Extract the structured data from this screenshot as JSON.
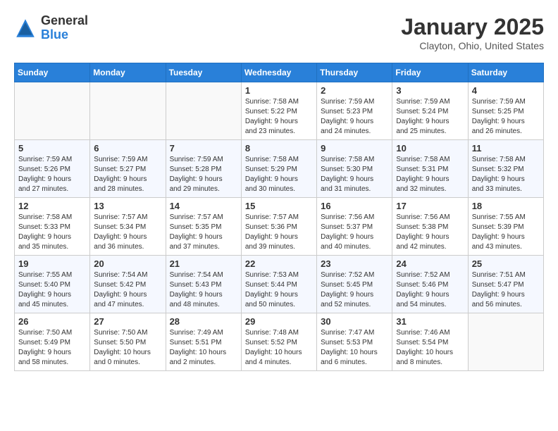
{
  "header": {
    "logo_general": "General",
    "logo_blue": "Blue",
    "month": "January 2025",
    "location": "Clayton, Ohio, United States"
  },
  "weekdays": [
    "Sunday",
    "Monday",
    "Tuesday",
    "Wednesday",
    "Thursday",
    "Friday",
    "Saturday"
  ],
  "weeks": [
    [
      {
        "day": "",
        "info": ""
      },
      {
        "day": "",
        "info": ""
      },
      {
        "day": "",
        "info": ""
      },
      {
        "day": "1",
        "info": "Sunrise: 7:58 AM\nSunset: 5:22 PM\nDaylight: 9 hours\nand 23 minutes."
      },
      {
        "day": "2",
        "info": "Sunrise: 7:59 AM\nSunset: 5:23 PM\nDaylight: 9 hours\nand 24 minutes."
      },
      {
        "day": "3",
        "info": "Sunrise: 7:59 AM\nSunset: 5:24 PM\nDaylight: 9 hours\nand 25 minutes."
      },
      {
        "day": "4",
        "info": "Sunrise: 7:59 AM\nSunset: 5:25 PM\nDaylight: 9 hours\nand 26 minutes."
      }
    ],
    [
      {
        "day": "5",
        "info": "Sunrise: 7:59 AM\nSunset: 5:26 PM\nDaylight: 9 hours\nand 27 minutes."
      },
      {
        "day": "6",
        "info": "Sunrise: 7:59 AM\nSunset: 5:27 PM\nDaylight: 9 hours\nand 28 minutes."
      },
      {
        "day": "7",
        "info": "Sunrise: 7:59 AM\nSunset: 5:28 PM\nDaylight: 9 hours\nand 29 minutes."
      },
      {
        "day": "8",
        "info": "Sunrise: 7:58 AM\nSunset: 5:29 PM\nDaylight: 9 hours\nand 30 minutes."
      },
      {
        "day": "9",
        "info": "Sunrise: 7:58 AM\nSunset: 5:30 PM\nDaylight: 9 hours\nand 31 minutes."
      },
      {
        "day": "10",
        "info": "Sunrise: 7:58 AM\nSunset: 5:31 PM\nDaylight: 9 hours\nand 32 minutes."
      },
      {
        "day": "11",
        "info": "Sunrise: 7:58 AM\nSunset: 5:32 PM\nDaylight: 9 hours\nand 33 minutes."
      }
    ],
    [
      {
        "day": "12",
        "info": "Sunrise: 7:58 AM\nSunset: 5:33 PM\nDaylight: 9 hours\nand 35 minutes."
      },
      {
        "day": "13",
        "info": "Sunrise: 7:57 AM\nSunset: 5:34 PM\nDaylight: 9 hours\nand 36 minutes."
      },
      {
        "day": "14",
        "info": "Sunrise: 7:57 AM\nSunset: 5:35 PM\nDaylight: 9 hours\nand 37 minutes."
      },
      {
        "day": "15",
        "info": "Sunrise: 7:57 AM\nSunset: 5:36 PM\nDaylight: 9 hours\nand 39 minutes."
      },
      {
        "day": "16",
        "info": "Sunrise: 7:56 AM\nSunset: 5:37 PM\nDaylight: 9 hours\nand 40 minutes."
      },
      {
        "day": "17",
        "info": "Sunrise: 7:56 AM\nSunset: 5:38 PM\nDaylight: 9 hours\nand 42 minutes."
      },
      {
        "day": "18",
        "info": "Sunrise: 7:55 AM\nSunset: 5:39 PM\nDaylight: 9 hours\nand 43 minutes."
      }
    ],
    [
      {
        "day": "19",
        "info": "Sunrise: 7:55 AM\nSunset: 5:40 PM\nDaylight: 9 hours\nand 45 minutes."
      },
      {
        "day": "20",
        "info": "Sunrise: 7:54 AM\nSunset: 5:42 PM\nDaylight: 9 hours\nand 47 minutes."
      },
      {
        "day": "21",
        "info": "Sunrise: 7:54 AM\nSunset: 5:43 PM\nDaylight: 9 hours\nand 48 minutes."
      },
      {
        "day": "22",
        "info": "Sunrise: 7:53 AM\nSunset: 5:44 PM\nDaylight: 9 hours\nand 50 minutes."
      },
      {
        "day": "23",
        "info": "Sunrise: 7:52 AM\nSunset: 5:45 PM\nDaylight: 9 hours\nand 52 minutes."
      },
      {
        "day": "24",
        "info": "Sunrise: 7:52 AM\nSunset: 5:46 PM\nDaylight: 9 hours\nand 54 minutes."
      },
      {
        "day": "25",
        "info": "Sunrise: 7:51 AM\nSunset: 5:47 PM\nDaylight: 9 hours\nand 56 minutes."
      }
    ],
    [
      {
        "day": "26",
        "info": "Sunrise: 7:50 AM\nSunset: 5:49 PM\nDaylight: 9 hours\nand 58 minutes."
      },
      {
        "day": "27",
        "info": "Sunrise: 7:50 AM\nSunset: 5:50 PM\nDaylight: 10 hours\nand 0 minutes."
      },
      {
        "day": "28",
        "info": "Sunrise: 7:49 AM\nSunset: 5:51 PM\nDaylight: 10 hours\nand 2 minutes."
      },
      {
        "day": "29",
        "info": "Sunrise: 7:48 AM\nSunset: 5:52 PM\nDaylight: 10 hours\nand 4 minutes."
      },
      {
        "day": "30",
        "info": "Sunrise: 7:47 AM\nSunset: 5:53 PM\nDaylight: 10 hours\nand 6 minutes."
      },
      {
        "day": "31",
        "info": "Sunrise: 7:46 AM\nSunset: 5:54 PM\nDaylight: 10 hours\nand 8 minutes."
      },
      {
        "day": "",
        "info": ""
      }
    ]
  ]
}
